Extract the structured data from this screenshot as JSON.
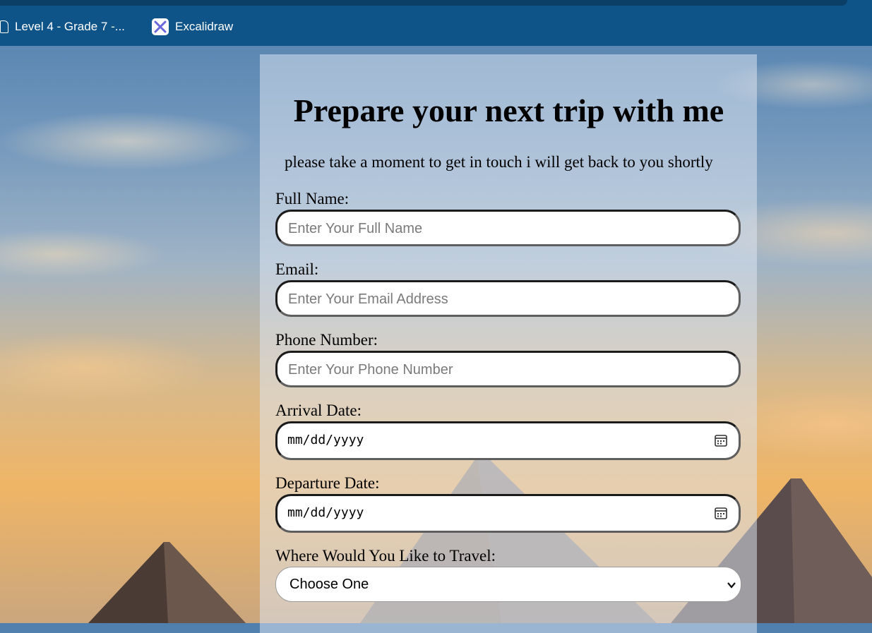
{
  "bookmarks": [
    {
      "label": "Level 4 - Grade 7 -...",
      "icon": "page-icon"
    },
    {
      "label": "Excalidraw",
      "icon": "excalidraw-icon"
    }
  ],
  "form": {
    "title": "Prepare your next trip with me",
    "subtitle": "please take a moment to get in touch i will get back to you shortly",
    "full_name": {
      "label": "Full Name:",
      "placeholder": "Enter Your Full Name"
    },
    "email": {
      "label": "Email:",
      "placeholder": "Enter Your Email Address"
    },
    "phone": {
      "label": "Phone Number:",
      "placeholder": "Enter Your Phone Number"
    },
    "arrival": {
      "label": "Arrival Date:",
      "value": "mm/dd/yyyy",
      "icon": "calendar-icon"
    },
    "departure": {
      "label": "Departure Date:",
      "value": "mm/dd/yyyy",
      "icon": "calendar-icon"
    },
    "destination": {
      "label": "Where Would You Like to Travel:",
      "selected": "Choose One",
      "icon": "chevron-down-icon"
    }
  },
  "colors": {
    "browser_bar": "#0f5488",
    "card_overlay": "#dee6f2",
    "field_border": "#1b1b1b"
  }
}
